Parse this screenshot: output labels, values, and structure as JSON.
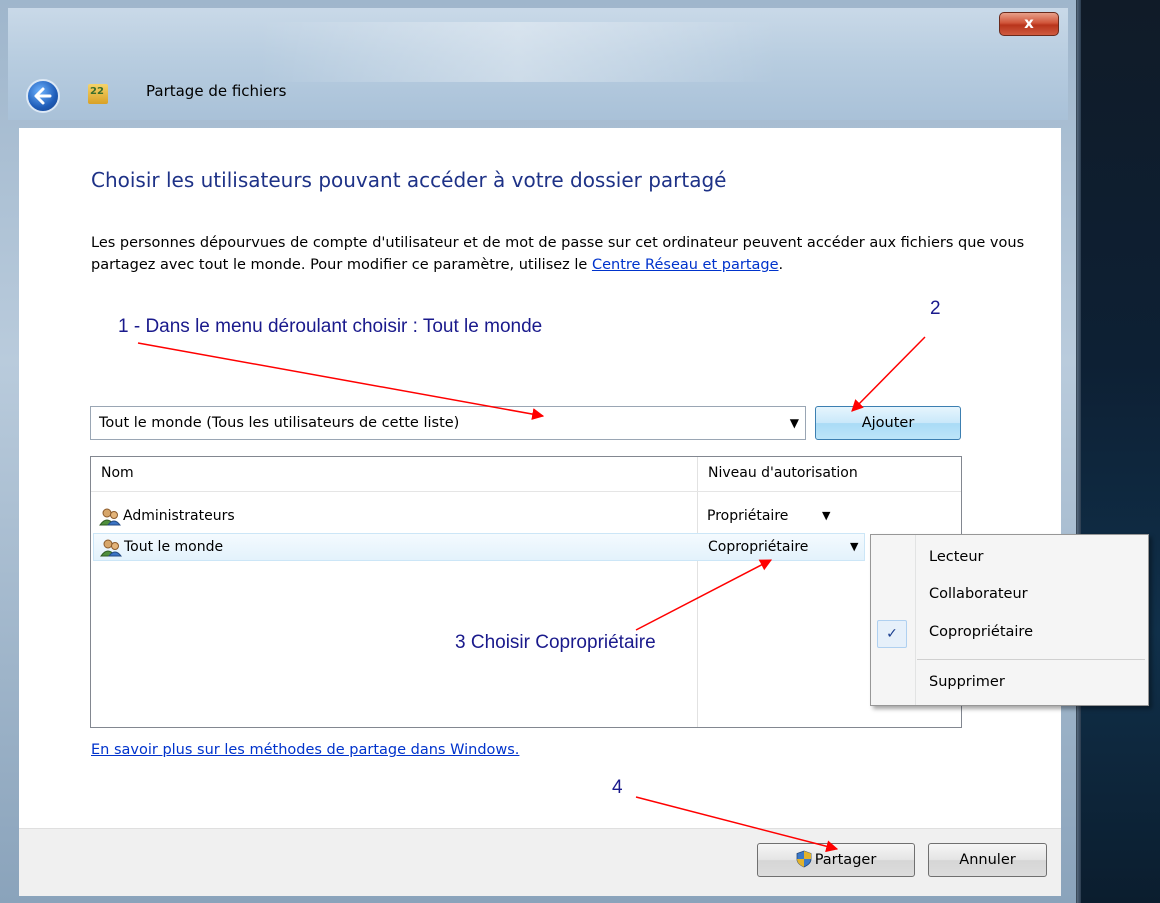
{
  "window": {
    "title": "Partage de fichiers",
    "close_label": "x"
  },
  "content": {
    "heading": "Choisir les utilisateurs pouvant accéder à votre dossier partagé",
    "description": "Les personnes dépourvues de compte d'utilisateur et de mot de passe sur cet ordinateur peuvent accéder aux fichiers que vous partagez avec tout le monde. Pour modifier ce paramètre, utilisez le",
    "description_link": "Centre Réseau et partage",
    "description_end": "."
  },
  "combo": {
    "value": "Tout le monde (Tous les utilisateurs de cette liste)"
  },
  "buttons": {
    "add": "Ajouter",
    "share": "Partager",
    "cancel": "Annuler"
  },
  "table": {
    "columns": [
      "Nom",
      "Niveau d'autorisation"
    ],
    "rows": [
      {
        "name": "Administrateurs",
        "level": "Propriétaire"
      },
      {
        "name": "Tout le monde",
        "level": "Copropriétaire"
      }
    ]
  },
  "menu": {
    "items": [
      "Lecteur",
      "Collaborateur",
      "Copropriétaire",
      "Supprimer"
    ],
    "checked": "Copropriétaire"
  },
  "learn_more": "En savoir plus sur les méthodes de partage dans Windows.",
  "annotations": {
    "step1": "1 - Dans le menu déroulant choisir : Tout le monde",
    "step2": "2",
    "step3": "3 Choisir Copropriétaire",
    "step4": "4",
    "arrow_color": "#ff0000",
    "text_color": "#1a1a8c"
  }
}
